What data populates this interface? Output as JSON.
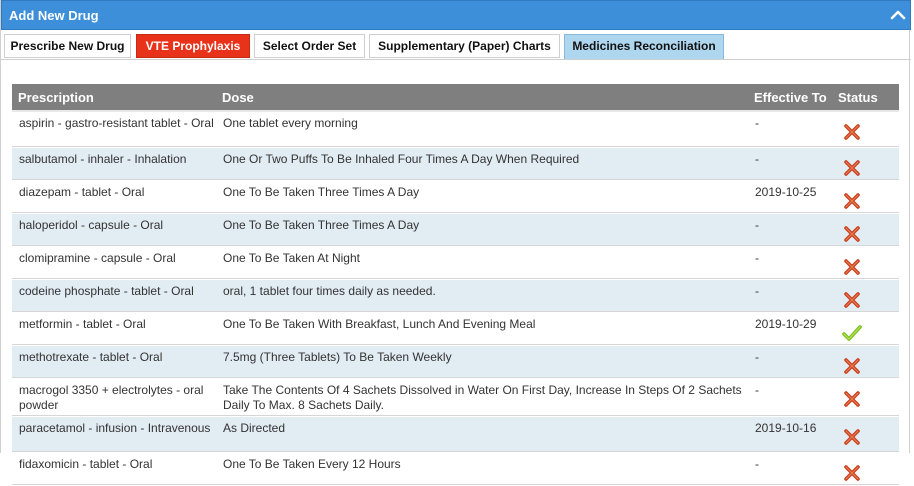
{
  "header": {
    "title": "Add New Drug"
  },
  "tabs": [
    {
      "label": "Prescribe New Drug"
    },
    {
      "label": "VTE Prophylaxis"
    },
    {
      "label": "Select Order Set"
    },
    {
      "label": "Supplementary (Paper) Charts"
    },
    {
      "label": "Medicines Reconciliation"
    }
  ],
  "table": {
    "columns": [
      "Prescription",
      "Dose",
      "Effective To",
      "Status"
    ],
    "rows": [
      {
        "prescription": "aspirin - gastro-resistant tablet - Oral",
        "dose": "One tablet every morning",
        "effective_to": "-",
        "status": "cross-icon"
      },
      {
        "prescription": "salbutamol - inhaler - Inhalation",
        "dose": "One Or Two Puffs To Be Inhaled Four Times A Day When Required",
        "effective_to": "-",
        "status": "cross-icon"
      },
      {
        "prescription": "diazepam - tablet - Oral",
        "dose": "One To Be Taken Three Times A Day",
        "effective_to": "2019-10-25",
        "status": "cross-icon"
      },
      {
        "prescription": "haloperidol - capsule - Oral",
        "dose": "One To Be Taken Three Times A Day",
        "effective_to": "-",
        "status": "cross-icon"
      },
      {
        "prescription": "clomipramine - capsule - Oral",
        "dose": "One To Be Taken At Night",
        "effective_to": "-",
        "status": "cross-icon"
      },
      {
        "prescription": "codeine phosphate - tablet - Oral",
        "dose": "oral, 1 tablet four times daily as needed.",
        "effective_to": "-",
        "status": "cross-icon"
      },
      {
        "prescription": "metformin - tablet - Oral",
        "dose": "One To Be Taken With Breakfast, Lunch And Evening Meal",
        "effective_to": "2019-10-29",
        "status": "check-icon"
      },
      {
        "prescription": "methotrexate - tablet - Oral",
        "dose": "7.5mg (Three Tablets) To Be Taken Weekly",
        "effective_to": "-",
        "status": "cross-icon"
      },
      {
        "prescription": "macrogol 3350 + electrolytes - oral powder",
        "dose": "Take The Contents Of 4 Sachets Dissolved in Water On First Day, Increase In Steps Of 2 Sachets Daily To Max. 8 Sachets Daily.",
        "effective_to": "-",
        "status": "cross-icon"
      },
      {
        "prescription": "paracetamol - infusion - Intravenous",
        "dose": "As Directed",
        "effective_to": "2019-10-16",
        "status": "cross-icon"
      },
      {
        "prescription": "fidaxomicin - tablet - Oral",
        "dose": "One To Be Taken Every 12 Hours",
        "effective_to": "-",
        "status": "cross-icon"
      }
    ]
  },
  "colors": {
    "header_bg": "#3d8fd9",
    "vte_tab": "#e8331a",
    "active_tab": "#aed6ee",
    "table_head": "#7f7f7f",
    "row_alt": "#e2ecf3",
    "cross": "#c8401c",
    "check": "#7cbf1e"
  }
}
